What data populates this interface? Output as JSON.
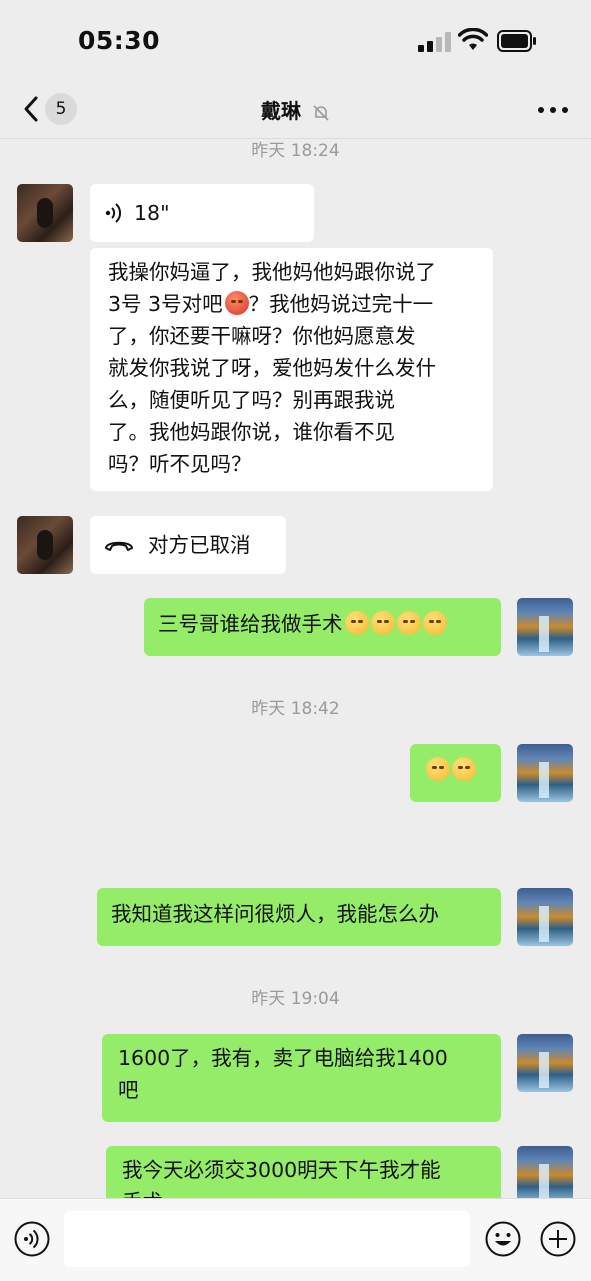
{
  "status_bar": {
    "time": "05:30"
  },
  "header": {
    "back_badge": "5",
    "title": "戴琳"
  },
  "messages": [
    {
      "type": "timestamp",
      "text": "昨天 18:24"
    },
    {
      "type": "voice",
      "side": "left",
      "duration": "18\""
    },
    {
      "type": "text",
      "side": "left",
      "lines": [
        "我操你妈逼了，我他妈他妈跟你说了",
        "3号 3号对吧",
        "了，你还要干嘛呀？你他妈愿意发",
        "就发你我说了呀，爱他妈发什么发什",
        "么，随便听见了吗？别再跟我说",
        "了。我他妈跟你说，谁你看不见",
        "吗？听不见吗？"
      ],
      "line2_tail": "？我他妈说过完十一"
    },
    {
      "type": "call",
      "side": "left",
      "text": "对方已取消"
    },
    {
      "type": "text",
      "side": "right",
      "text": "三号哥谁给我做手术"
    },
    {
      "type": "timestamp",
      "text": "昨天 18:42"
    },
    {
      "type": "emoji",
      "side": "right"
    },
    {
      "type": "text",
      "side": "right",
      "text": "我知道我这样问很烦人，我能怎么办"
    },
    {
      "type": "timestamp",
      "text": "昨天 19:04"
    },
    {
      "type": "text",
      "side": "right",
      "lines": [
        "1600了，我有，卖了电脑给我1400",
        "吧"
      ]
    },
    {
      "type": "text",
      "side": "right",
      "lines": [
        "我今天必须交3000明天下午我才能",
        "手术"
      ]
    }
  ],
  "icons": {
    "back": "chevron-left-icon",
    "mute": "bell-off-icon",
    "more": "more-dots-icon",
    "voice": "voice-wave-icon",
    "call": "phone-hangup-icon",
    "voice_input": "voice-input-icon",
    "emoji": "emoji-icon",
    "plus": "plus-icon"
  },
  "colors": {
    "background": "#ededed",
    "outgoing": "#95ec69",
    "incoming": "#ffffff",
    "timestamp": "#9a9a9a"
  }
}
